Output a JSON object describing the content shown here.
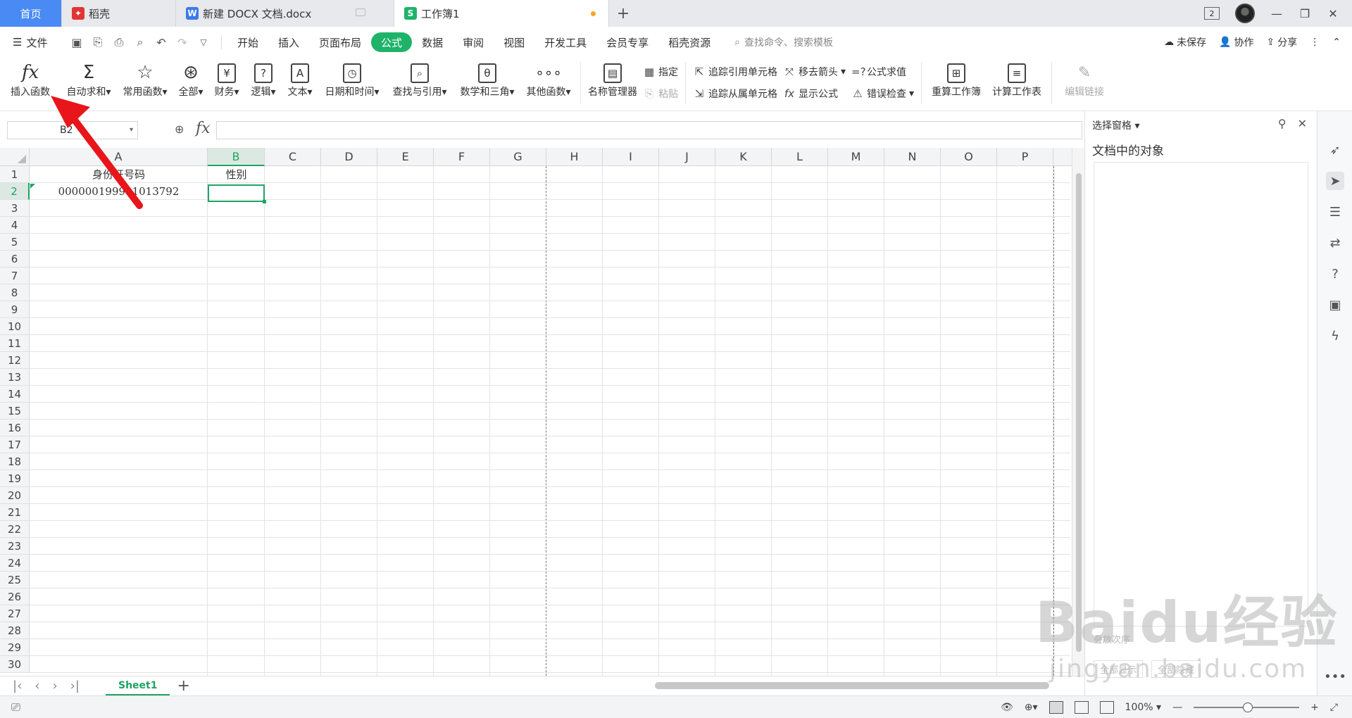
{
  "tabs": {
    "home": "首页",
    "daoke": "稻壳",
    "doc": "新建 DOCX 文档.docx",
    "workbook": "工作簿1",
    "window_badge": "2"
  },
  "menu": {
    "file": "文件",
    "items": [
      "开始",
      "插入",
      "页面布局",
      "公式",
      "数据",
      "审阅",
      "视图",
      "开发工具",
      "会员专享",
      "稻壳资源"
    ],
    "search": "查找命令、搜索模板",
    "unsaved": "未保存",
    "collab": "协作",
    "share": "分享"
  },
  "ribbon": {
    "insert_func": "插入函数",
    "autosum": "自动求和",
    "common": "常用函数",
    "all": "全部",
    "finance": "财务",
    "logic": "逻辑",
    "text": "文本",
    "datetime": "日期和时间",
    "lookup": "查找与引用",
    "math": "数学和三角",
    "other": "其他函数",
    "name_mgr": "名称管理器",
    "assign": "指定",
    "paste": "粘贴",
    "trace_prec": "追踪引用单元格",
    "trace_dep": "追踪从属单元格",
    "remove_arrows": "移去箭头",
    "show_formula": "显示公式",
    "eval_formula": "公式求值",
    "error_check": "错误检查",
    "recalc_book": "重算工作簿",
    "calc_sheet": "计算工作表",
    "edit_links": "编辑链接"
  },
  "formula_bar": {
    "name_box": "B2",
    "fx": "fx",
    "content": ""
  },
  "grid": {
    "columns": [
      "A",
      "B",
      "C",
      "D",
      "E",
      "F",
      "G",
      "H",
      "I",
      "J",
      "K",
      "L",
      "M",
      "N",
      "O",
      "P"
    ],
    "selected_column": "B",
    "selected_row": "2",
    "rows": [
      "1",
      "2",
      "3",
      "4",
      "5",
      "6",
      "7",
      "8",
      "9",
      "10",
      "11",
      "12",
      "13",
      "14",
      "15",
      "16",
      "17",
      "18",
      "19",
      "20",
      "21",
      "22",
      "23",
      "24",
      "25",
      "26",
      "27",
      "28",
      "29",
      "30"
    ],
    "a1": "身份证号码",
    "b1": "性别",
    "a2": "000000199901013792"
  },
  "sheets": {
    "active": "Sheet1"
  },
  "status": {
    "zoom": "100%"
  },
  "panel": {
    "title": "选择窗格",
    "subtitle": "文档中的对象",
    "order": "叠放次序",
    "show_all": "全部显示",
    "hide_all": "全部隐藏"
  },
  "watermark": {
    "brand": "Baidu经验",
    "url": "jingyan.baidu.com"
  },
  "colors": {
    "accent": "#1fb36a",
    "home_tab": "#4a8af4",
    "annotation": "#e8151b"
  }
}
